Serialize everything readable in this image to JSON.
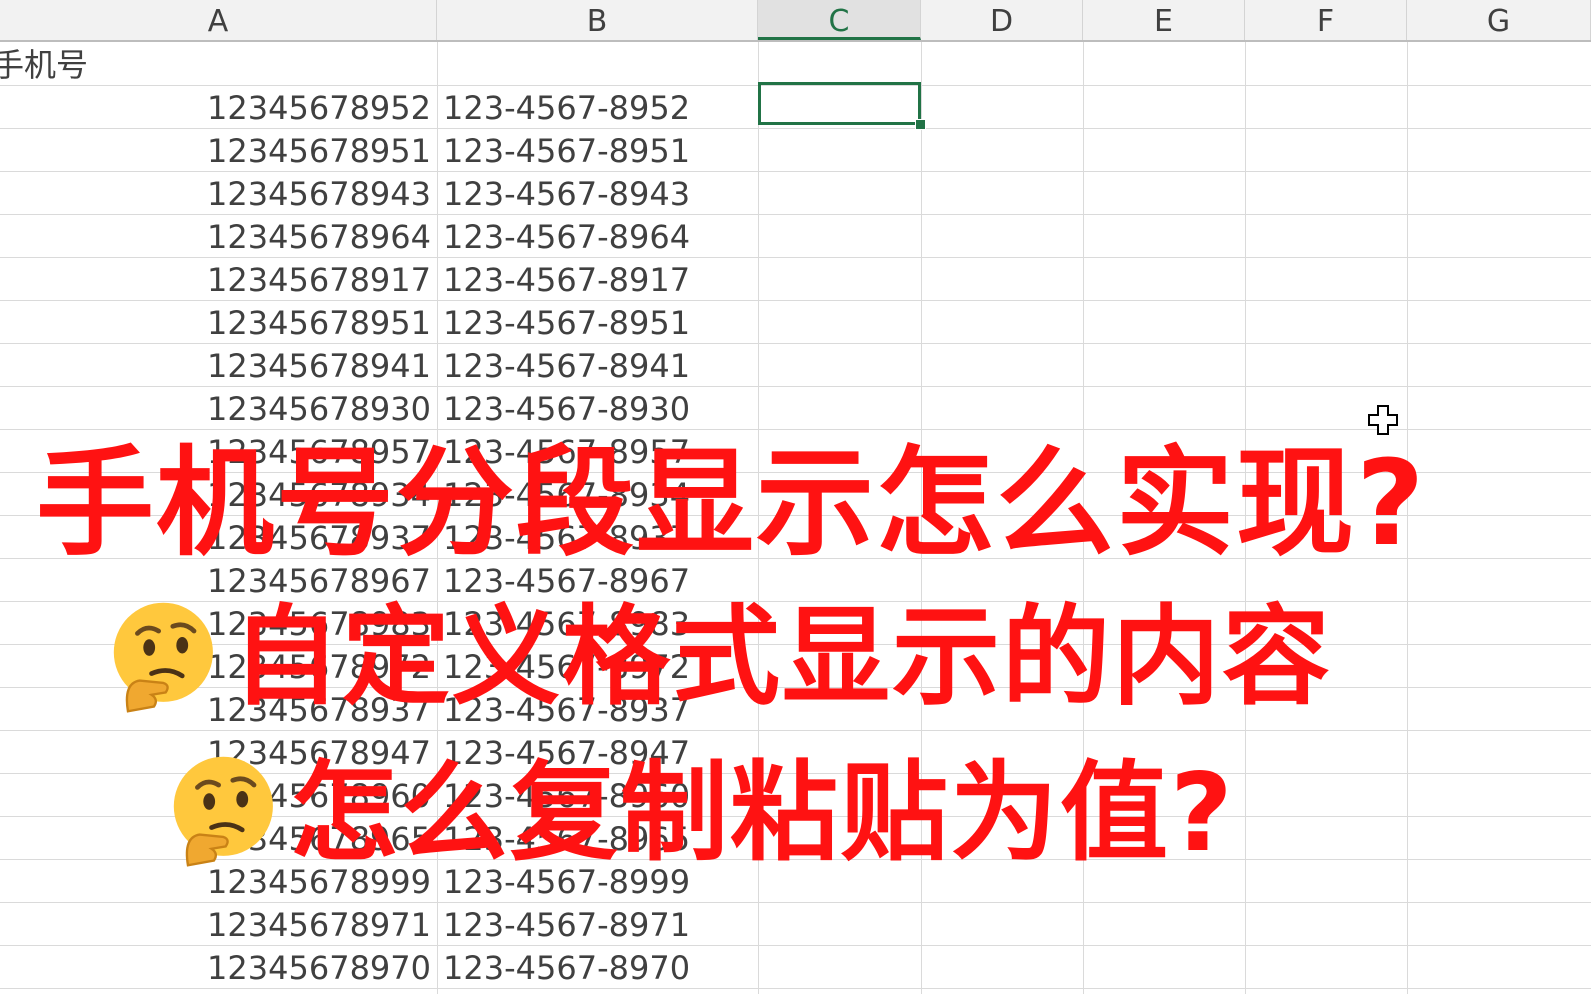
{
  "columns": [
    "A",
    "B",
    "C",
    "D",
    "E",
    "F",
    "G"
  ],
  "active_column": "C",
  "header_cell": "手机号",
  "rows": [
    {
      "raw": "12345678952",
      "formatted": "123-4567-8952"
    },
    {
      "raw": "12345678951",
      "formatted": "123-4567-8951"
    },
    {
      "raw": "12345678943",
      "formatted": "123-4567-8943"
    },
    {
      "raw": "12345678964",
      "formatted": "123-4567-8964"
    },
    {
      "raw": "12345678917",
      "formatted": "123-4567-8917"
    },
    {
      "raw": "12345678951",
      "formatted": "123-4567-8951"
    },
    {
      "raw": "12345678941",
      "formatted": "123-4567-8941"
    },
    {
      "raw": "12345678930",
      "formatted": "123-4567-8930"
    },
    {
      "raw": "12345678957",
      "formatted": "123-4567-8957"
    },
    {
      "raw": "12345678934",
      "formatted": "123-4567-8934"
    },
    {
      "raw": "12345678937",
      "formatted": "123-4567-8937"
    },
    {
      "raw": "12345678967",
      "formatted": "123-4567-8967"
    },
    {
      "raw": "12345678983",
      "formatted": "123-4567-8983"
    },
    {
      "raw": "12345678972",
      "formatted": "123-4567-8972"
    },
    {
      "raw": "12345678937",
      "formatted": "123-4567-8937"
    },
    {
      "raw": "12345678947",
      "formatted": "123-4567-8947"
    },
    {
      "raw": "12345678960",
      "formatted": "123-4567-8960"
    },
    {
      "raw": "12345678965",
      "formatted": "123-4567-8965"
    },
    {
      "raw": "12345678999",
      "formatted": "123-4567-8999"
    },
    {
      "raw": "12345678971",
      "formatted": "123-4567-8971"
    },
    {
      "raw": "12345678970",
      "formatted": "123-4567-8970"
    }
  ],
  "overlay": {
    "line1": "手机号分段显示怎么实现?",
    "line2": "自定义格式显示的内容",
    "line3": "怎么复制粘贴为值?",
    "emoji_icon": "thinking-face-icon"
  },
  "colors": {
    "selection": "#217346",
    "caption": "#ff1212",
    "header_bg": "#f2f2f2",
    "grid": "#dadada"
  }
}
